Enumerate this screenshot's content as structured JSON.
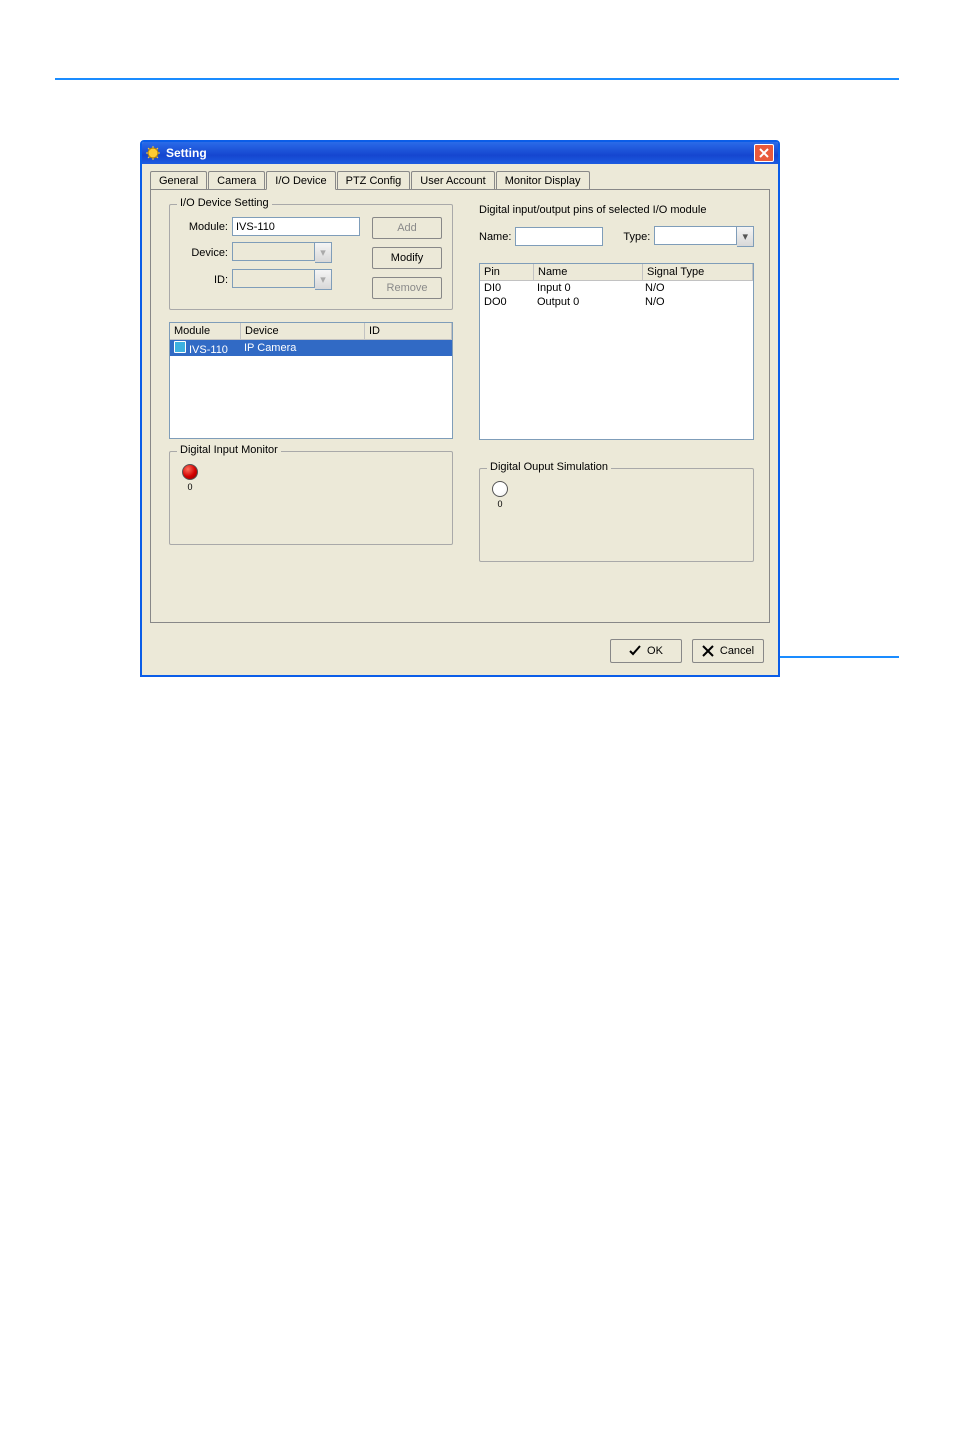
{
  "window": {
    "title": "Setting"
  },
  "tabs": [
    "General",
    "Camera",
    "I/O Device",
    "PTZ Config",
    "User Account",
    "Monitor Display"
  ],
  "io_setting": {
    "legend": "I/O Device Setting",
    "module_lbl": "Module:",
    "module_val": "IVS-110",
    "device_lbl": "Device:",
    "device_val": "",
    "id_lbl": "ID:",
    "id_val": "",
    "btn_add": "Add",
    "btn_modify": "Modify",
    "btn_remove": "Remove",
    "list_head": {
      "module": "Module",
      "device": "Device",
      "id": "ID"
    },
    "list_row": {
      "module": "IVS-110",
      "device": "IP Camera",
      "id": ""
    }
  },
  "pins": {
    "title": "Digital input/output pins of selected I/O module",
    "name_lbl": "Name:",
    "name_val": "",
    "type_lbl": "Type:",
    "type_val": "",
    "head": {
      "pin": "Pin",
      "name": "Name",
      "sig": "Signal Type"
    },
    "rows": [
      {
        "pin": "DI0",
        "name": "Input 0",
        "sig": "N/O"
      },
      {
        "pin": "DO0",
        "name": "Output 0",
        "sig": "N/O"
      }
    ]
  },
  "dim": {
    "legend": "Digital Input Monitor",
    "label": "0"
  },
  "dos": {
    "legend": "Digital Ouput Simulation",
    "label": "0"
  },
  "buttons": {
    "ok": "OK",
    "cancel": "Cancel"
  }
}
